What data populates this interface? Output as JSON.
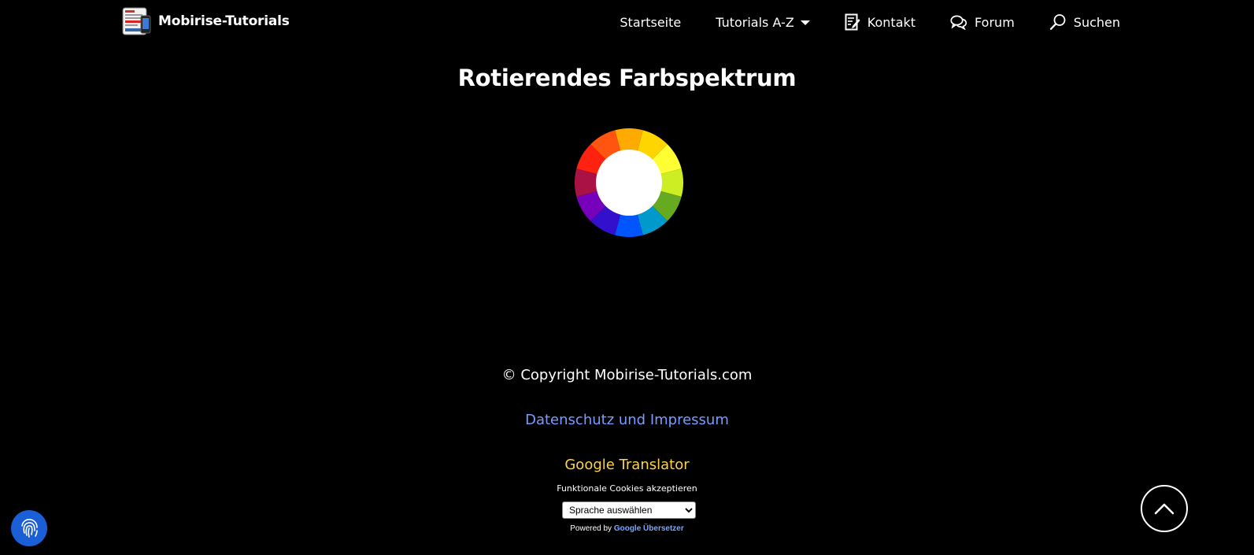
{
  "navbar": {
    "brand_name": "Mobirise-Tutorials",
    "items": [
      {
        "label": "Startseite",
        "icon": ""
      },
      {
        "label": "Tutorials A-Z",
        "icon": "chevron-down-icon"
      },
      {
        "label": "Kontakt",
        "icon": "edit-note-icon"
      },
      {
        "label": "Forum",
        "icon": "chat-bubbles-icon"
      },
      {
        "label": "Suchen",
        "icon": "search-icon"
      }
    ]
  },
  "main": {
    "title": "Rotierendes Farbspektrum",
    "wheel_colors": [
      "#ffaa00",
      "#ffd500",
      "#ffff33",
      "#ccee22",
      "#66aa22",
      "#0099cc",
      "#0055ff",
      "#3311cc",
      "#7700bb",
      "#aa1144",
      "#ff2211",
      "#ff5511"
    ]
  },
  "footer": {
    "copyright": "© Copyright Mobirise-Tutorials.com",
    "privacy_link": "Datenschutz und Impressum",
    "translator_title": "Google Translator",
    "cookies_label": "Funktionale Cookies akzeptieren",
    "language_select": "Sprache auswählen",
    "powered_by": "Powered by",
    "powered_link": "Google Übersetzer"
  },
  "colors": {
    "background": "#000000",
    "link": "#7a9cff",
    "translator_title": "#ffd24d",
    "fingerprint_button": "#1a5fd6"
  }
}
